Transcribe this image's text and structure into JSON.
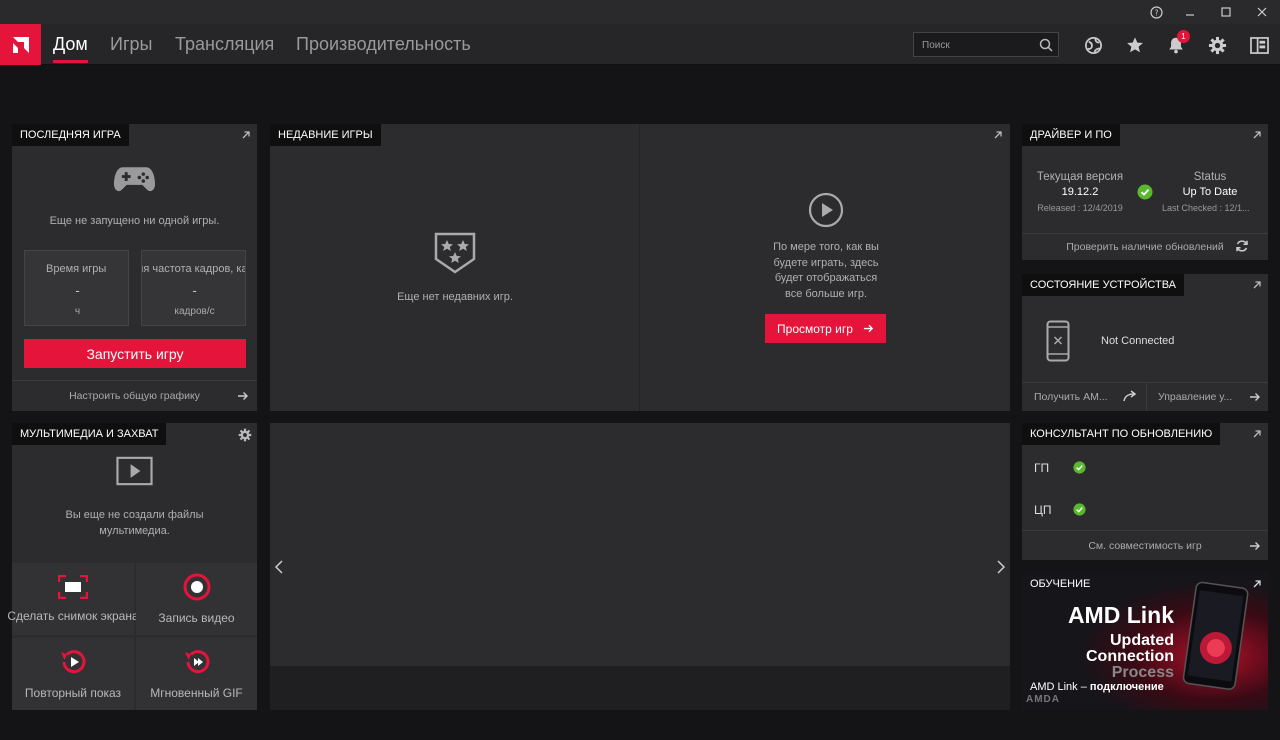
{
  "nav": {
    "tabs": [
      "Дом",
      "Игры",
      "Трансляция",
      "Производительность"
    ]
  },
  "search": {
    "placeholder": "Поиск"
  },
  "notifications": {
    "count": "1"
  },
  "last_game": {
    "title": "ПОСЛЕДНЯЯ ИГРА",
    "empty_text": "Еще не запущено ни одной игры.",
    "play_time_label": "Время игры",
    "play_time_value": "-",
    "play_time_unit": "ч",
    "fps_label": "Средняя частота кадров, кадров/с",
    "fps_value": "-",
    "fps_unit": "кадров/с",
    "launch_button": "Запустить игру",
    "global_graphics_link": "Настроить общую графику"
  },
  "recent_games": {
    "title": "НЕДАВНИЕ ИГРЫ",
    "empty_text": "Еще нет недавних игр.",
    "hint_text": "По мере того, как вы будете играть, здесь будет отображаться все больше игр.",
    "browse_button": "Просмотр игр"
  },
  "driver": {
    "title": "ДРАЙВЕР И ПО",
    "current_version_label": "Текущая версия",
    "version": "19.12.2",
    "released": "Released : 12/4/2019",
    "status_label": "Status",
    "status_value": "Up To Date",
    "last_checked": "Last Checked : 12/1...",
    "check_updates_link": "Проверить наличие обновлений"
  },
  "device": {
    "title": "СОСТОЯНИЕ УСТРОЙСТВА",
    "status": "Not Connected",
    "get_amd_link": "Получить AM...",
    "manage_link": "Управление у..."
  },
  "media": {
    "title": "МУЛЬТИМЕДИА И ЗАХВАТ",
    "empty_text": "Вы еще не создали файлы мультимедиа.",
    "screenshot": "Сделать снимок экрана",
    "record": "Запись видео",
    "replay": "Повторный показ",
    "gif": "Мгновенный GIF"
  },
  "upgrade": {
    "title": "КОНСУЛЬТАНТ ПО ОБНОВЛЕНИЮ",
    "gpu_label": "ГП",
    "cpu_label": "ЦП",
    "compat_link": "См. совместимость игр"
  },
  "learning": {
    "title": "ОБУЧЕНИЕ",
    "headline": "AMD Link",
    "line1": "Updated",
    "line2": "Connection",
    "line3": "Process",
    "caption_normal": "AMD Link – ",
    "caption_bold": "подключение",
    "brand": "AMDA"
  },
  "colors": {
    "accent": "#e4143a",
    "ok": "#5ab82e",
    "panel": "#2c2c2e",
    "header": "#0f0f10"
  }
}
